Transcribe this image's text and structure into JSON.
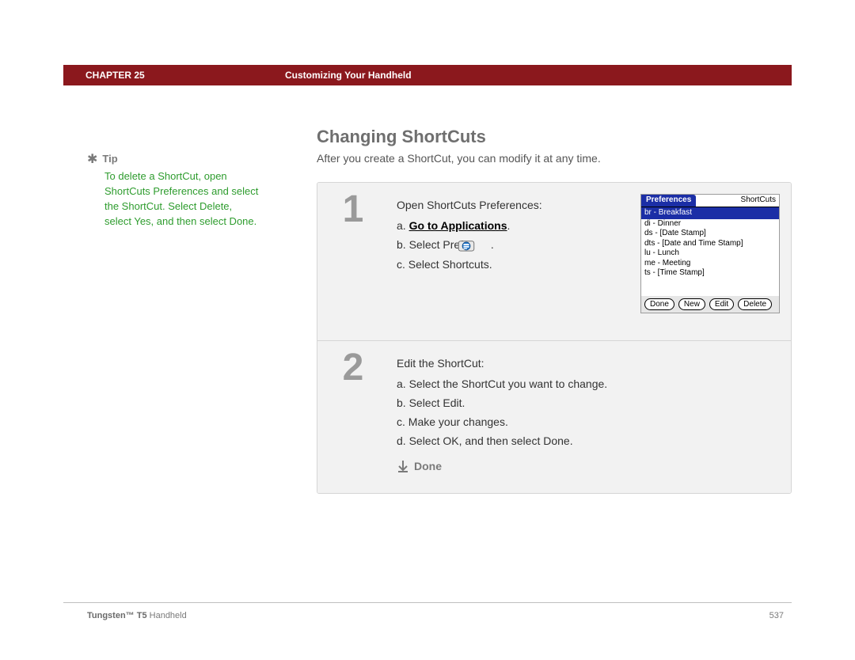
{
  "header": {
    "chapter": "CHAPTER 25",
    "title": "Customizing Your Handheld"
  },
  "sidebar": {
    "tip_label": "Tip",
    "tip_body": "To delete a ShortCut, open ShortCuts Preferences and select the ShortCut. Select Delete, select Yes, and then select Done."
  },
  "main": {
    "heading": "Changing ShortCuts",
    "intro": "After you create a ShortCut, you can modify it at any time."
  },
  "steps": [
    {
      "num": "1",
      "lead": "Open ShortCuts Preferences:",
      "items": {
        "a_prefix": "a.",
        "a_link": "Go to Applications",
        "a_suffix": ".",
        "b_prefix": "b.",
        "b_text": "Select Prefs ",
        "b_suffix": ".",
        "c_prefix": "c.",
        "c_text": "Select Shortcuts."
      }
    },
    {
      "num": "2",
      "lead": "Edit the ShortCut:",
      "items": {
        "a": "a.  Select the ShortCut you want to change.",
        "b": "b.  Select Edit.",
        "c": "c.  Make your changes.",
        "d": "d.  Select OK, and then select Done."
      },
      "done_label": "Done"
    }
  ],
  "palm": {
    "title_left": "Preferences",
    "title_right": "ShortCuts",
    "list": [
      "br - Breakfast",
      "di - Dinner",
      "ds - [Date Stamp]",
      "dts - [Date and Time Stamp]",
      "lu - Lunch",
      "me - Meeting",
      "ts - [Time Stamp]"
    ],
    "buttons": [
      "Done",
      "New",
      "Edit",
      "Delete"
    ]
  },
  "footer": {
    "product_bold": "Tungsten™ T5",
    "product_rest": " Handheld",
    "page": "537"
  }
}
